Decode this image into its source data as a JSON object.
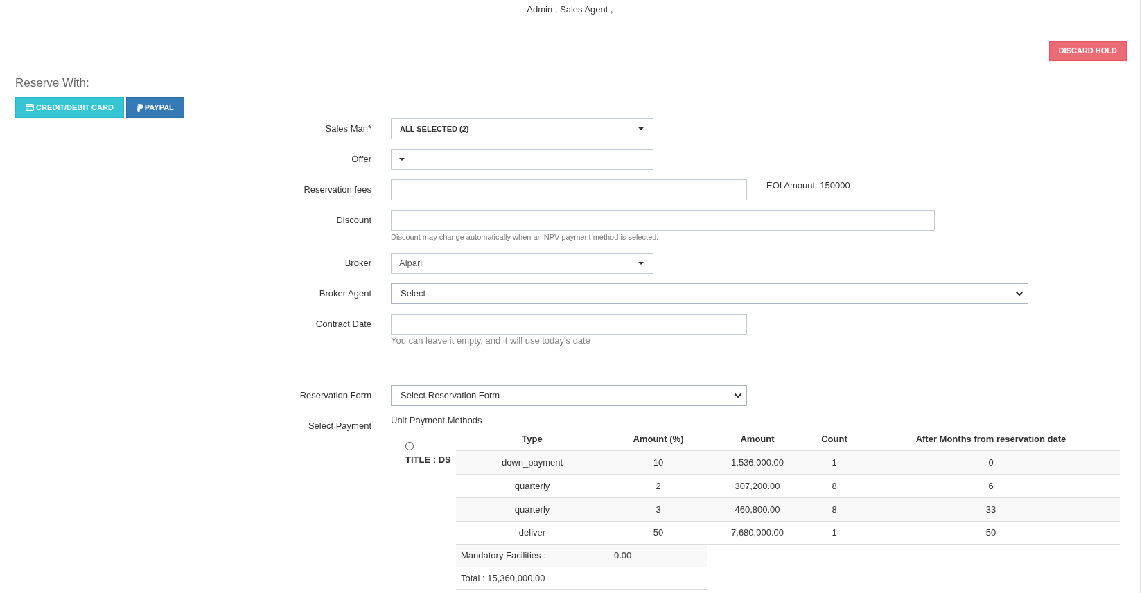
{
  "header": {
    "text": "Admin , Sales Agent ,"
  },
  "actions": {
    "discard_button": "DISCARD HOLD"
  },
  "reserve_with": {
    "title": "Reserve With:",
    "buttons": [
      {
        "kind": "card",
        "label": "CREDIT/DEBIT CARD"
      },
      {
        "kind": "paypal",
        "label": "PAYPAL"
      }
    ]
  },
  "form": {
    "fields": [
      {
        "kind": "multiselect",
        "label": "Sales Man*",
        "value": "ALL SELECTED (2)"
      },
      {
        "kind": "dropdown",
        "label": "Offer"
      },
      {
        "kind": "input",
        "label": "Reservation fees",
        "note": "EOI Amount: 150000"
      },
      {
        "kind": "wideinput",
        "label": "Discount",
        "help": "Discount may change automatically when an NPV payment method is selected."
      },
      {
        "kind": "dropdown",
        "label": "Broker",
        "value": "Alpari"
      },
      {
        "kind": "wideselect",
        "label": "Broker Agent",
        "value": "Select"
      },
      {
        "kind": "input",
        "label": "Contract Date",
        "help": "You can leave it empty, and it will use today's date"
      }
    ]
  },
  "reservation_form": {
    "label": "Reservation Form",
    "value": "Select Reservation Form"
  },
  "payment": {
    "label": "Select Payment",
    "title": "Unit Payment Methods",
    "options": [
      {
        "title": "TITLE : DS",
        "selected": false,
        "columns": [
          "Type",
          "Amount (%)",
          "Amount",
          "Count",
          "After Months from reservation date"
        ],
        "rows": [
          [
            "down_payment",
            "10",
            "1,536,000.00",
            "1",
            "0"
          ],
          [
            "quarterly",
            "2",
            "307,200.00",
            "8",
            "6"
          ],
          [
            "quarterly",
            "3",
            "460,800.00",
            "8",
            "33"
          ],
          [
            "deliver",
            "50",
            "7,680,000.00",
            "1",
            "50"
          ]
        ],
        "summary": [
          {
            "label": "Mandatory Facilities :",
            "value": "0.00"
          },
          {
            "label": "Total : 15,360,000.00"
          }
        ]
      }
    ]
  }
}
